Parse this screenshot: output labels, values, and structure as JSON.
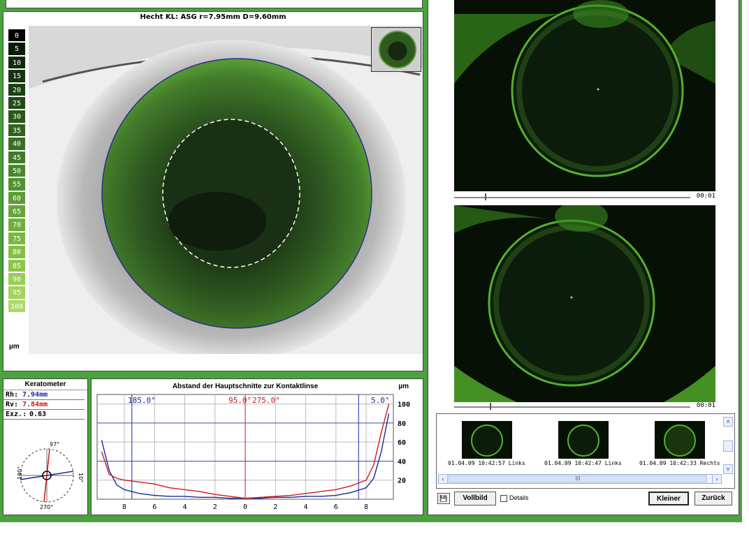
{
  "topography": {
    "title": "Hecht KL: ASG r=7.95mm  D=9.60mm",
    "scale_values": [
      "0",
      "5",
      "10",
      "15",
      "20",
      "25",
      "30",
      "35",
      "40",
      "45",
      "50",
      "55",
      "60",
      "65",
      "70",
      "75",
      "80",
      "85",
      "90",
      "95",
      "100"
    ],
    "scale_colors": [
      "#000000",
      "#0a1a08",
      "#112a0d",
      "#163510",
      "#1b4013",
      "#224c17",
      "#29581b",
      "#30641f",
      "#387023",
      "#407c27",
      "#48882b",
      "#52922f",
      "#5c9c34",
      "#66a638",
      "#70ae3c",
      "#7ab640",
      "#84be46",
      "#8ec64c",
      "#98cd54",
      "#a2d35c",
      "#acd966"
    ],
    "scale_unit": "µm"
  },
  "keratometer": {
    "title": "Keratometer",
    "rh_label": "Rh:",
    "rh_value": "7.94mm",
    "rv_label": "Rv:",
    "rv_value": "7.84mm",
    "exz_label": "Exz.:",
    "exz_value": "0.63",
    "angle_top": "97°",
    "angle_bottom": "270°",
    "angle_left": "180°",
    "angle_right": "10°"
  },
  "chart": {
    "title": "Abstand der Hauptschnitte zur Kontaktlinse",
    "unit": "µm",
    "meridian_labels": [
      {
        "text": "185.0°",
        "color": "#1a2a9a"
      },
      {
        "text": "95.0°",
        "color": "#cc1b1b"
      },
      {
        "text": "275.0°",
        "color": "#cc1b1b"
      },
      {
        "text": "5.0°",
        "color": "#1a2a9a"
      }
    ]
  },
  "chart_data": {
    "type": "line",
    "title": "Abstand der Hauptschnitte zur Kontaktlinse",
    "ylabel": "µm",
    "x_ticks": [
      "8",
      "6",
      "4",
      "2",
      "0",
      "2",
      "4",
      "6",
      "8"
    ],
    "y_ticks": [
      "20",
      "40",
      "60",
      "80",
      "100"
    ],
    "x": [
      -9.5,
      -9,
      -8.5,
      -8,
      -7,
      -6,
      -5,
      -4,
      -3,
      -2,
      -1,
      0,
      1,
      2,
      3,
      4,
      5,
      6,
      7,
      8,
      8.5,
      9,
      9.5
    ],
    "ylim": [
      0,
      110
    ],
    "series": [
      {
        "color": "#1a2a9a",
        "values": [
          62,
          30,
          15,
          10,
          6,
          4,
          3,
          3,
          2,
          2,
          1,
          1,
          1,
          2,
          2,
          3,
          3,
          4,
          7,
          12,
          22,
          50,
          90
        ]
      },
      {
        "color": "#cc1b1b",
        "values": [
          50,
          26,
          22,
          20,
          18,
          16,
          12,
          10,
          8,
          5,
          3,
          1,
          2,
          3,
          4,
          6,
          8,
          10,
          14,
          20,
          36,
          70,
          100
        ]
      }
    ]
  },
  "videos": [
    {
      "time": "00:01",
      "progress": 0.13
    },
    {
      "time": "00:01",
      "progress": 0.15
    }
  ],
  "gallery": {
    "items": [
      {
        "caption": "01.04.09 10:42:57 Links"
      },
      {
        "caption": "01.04.09 10:42:47 Links"
      },
      {
        "caption": "01.04.09 10:42:33 Rechts"
      }
    ],
    "scroll_text": "III"
  },
  "buttons": {
    "save_icon": "💾",
    "vollbild": "Vollbild",
    "details": "Details",
    "kleiner": "Kleiner",
    "zurueck": "Zurück"
  },
  "colors": {
    "frame": "#4aa33e",
    "lens_green": "#4f8f2a",
    "video_green": "#3a8a20"
  }
}
